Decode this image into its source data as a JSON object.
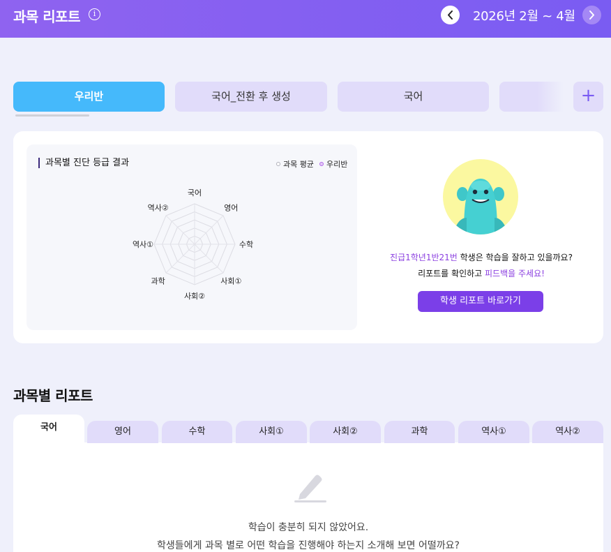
{
  "header": {
    "title": "과목 리포트",
    "date_range": "2026년 2월 ~ 4월",
    "icons": {
      "info": "info-circle-icon",
      "prev": "chevron-left-icon",
      "next": "chevron-right-icon"
    }
  },
  "class_tabs": [
    {
      "label": "우리반",
      "active": true
    },
    {
      "label": "국어_전환 후 생성",
      "active": false
    },
    {
      "label": "국어",
      "active": false
    },
    {
      "label": "",
      "active": false
    }
  ],
  "add_tab_icon": "plus-icon",
  "diagnosis": {
    "title": "과목별 진단 등급 결과",
    "legend": [
      {
        "label": "과목 평균",
        "color": "#c9c9d2"
      },
      {
        "label": "우리반",
        "color": "#b16ae8"
      }
    ],
    "axes": [
      "국어",
      "영어",
      "수학",
      "사회①",
      "사회②",
      "과학",
      "역사①",
      "역사②"
    ]
  },
  "student_card": {
    "student_name": "진급1학년1반21번",
    "question_suffix": " 학생은 학습을 잘하고 있을까요?",
    "feedback_prefix": "리포트를 확인하고 ",
    "feedback_highlight": "피드백을 주세요!",
    "button_label": "학생 리포트 바로가기",
    "mascot_icon": "mascot-avatar-icon"
  },
  "subject_reports": {
    "title": "과목별 리포트",
    "tabs": [
      "국어",
      "영어",
      "수학",
      "사회①",
      "사회②",
      "과학",
      "역사①",
      "역사②"
    ],
    "active_tab": "국어",
    "empty_icon": "pencil-icon",
    "empty_line1": "학습이 충분히 되지 않았어요.",
    "empty_line2": "학생들에게 과목 별로 어떤 학습을 진행해야 하는지 소개해 보면 어떨까요?"
  }
}
